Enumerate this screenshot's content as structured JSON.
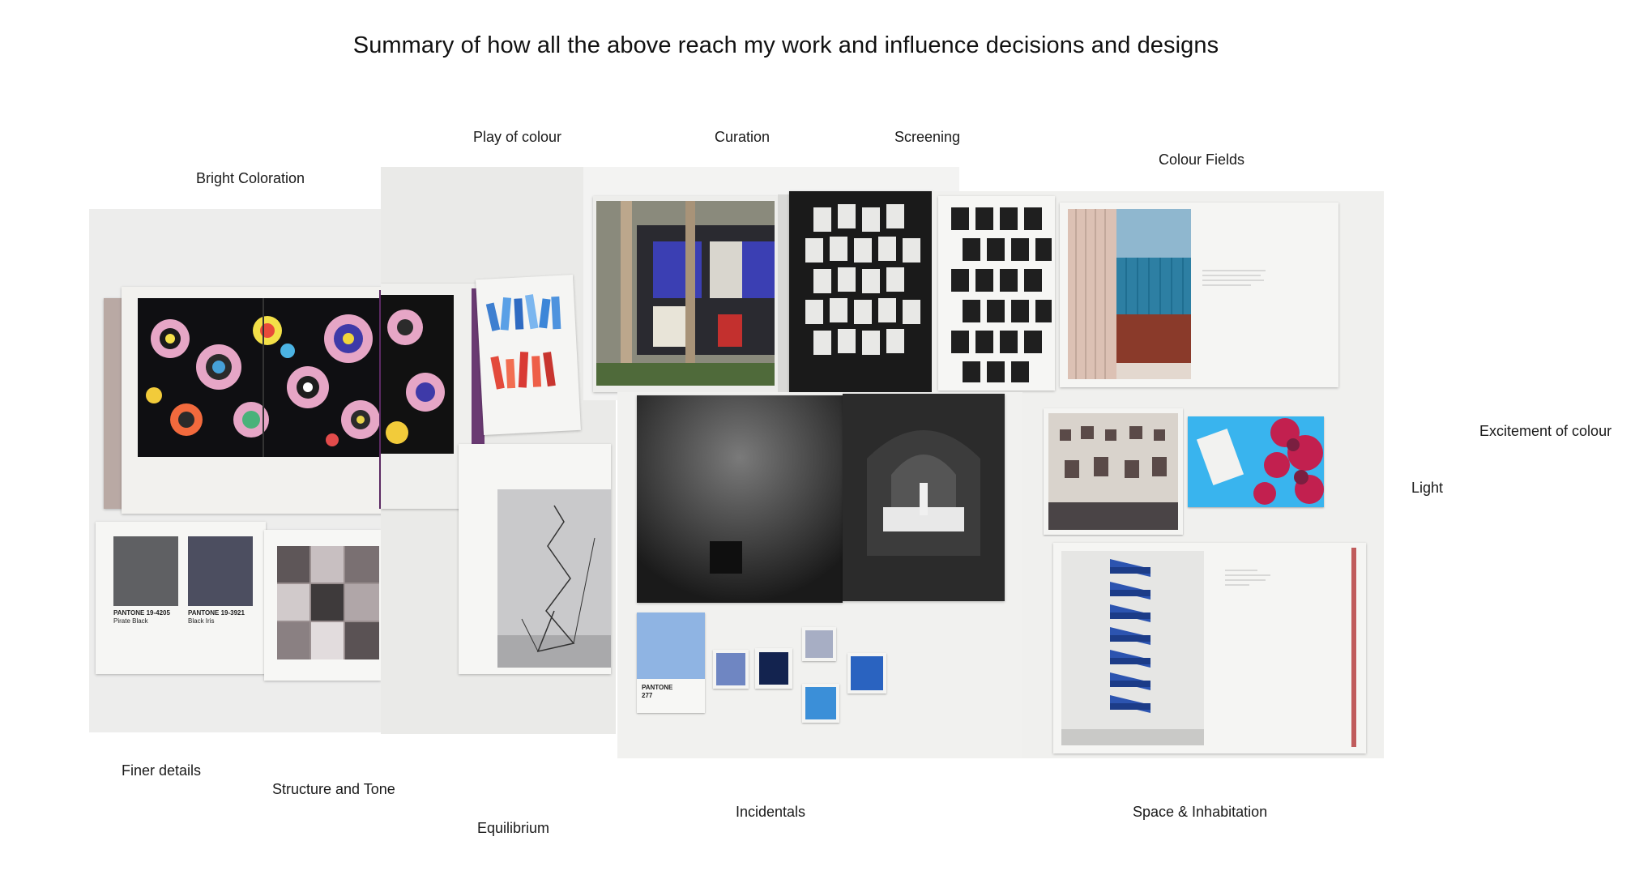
{
  "title": "Summary of how all the above reach my work and influence decisions and designs",
  "labels": {
    "bright_coloration": "Bright Coloration",
    "play_of_colour": "Play of colour",
    "curation": "Curation",
    "screening": "Screening",
    "colour_fields": "Colour Fields",
    "excitement_of_colour": "Excitement of colour",
    "light": "Light",
    "finer_details": "Finer details",
    "structure_and_tone": "Structure and Tone",
    "equilibrium": "Equilibrium",
    "incidentals": "Incidentals",
    "space_inhabitation": "Space & Inhabitation"
  },
  "swatches": {
    "pantone_a": "PANTONE 19-4205",
    "pantone_a_name": "Pirate Black",
    "pantone_b": "PANTONE 19-3921",
    "pantone_b_name": "Black Iris",
    "pantone_c": "PANTONE",
    "pantone_c_num": "277"
  }
}
